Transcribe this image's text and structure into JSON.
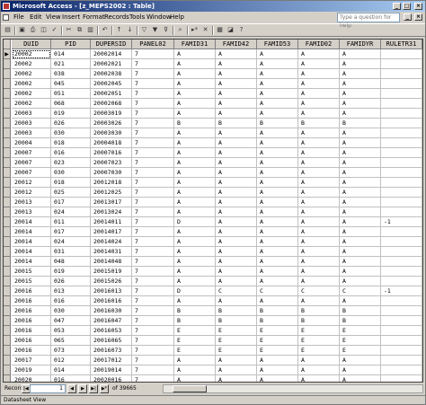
{
  "window": {
    "title": "Microsoft Access - [z_MEPS2002 : Table]"
  },
  "menu": [
    "File",
    "Edit",
    "View",
    "Insert",
    "Format",
    "Records",
    "Tools",
    "Window",
    "Help"
  ],
  "ask_placeholder": "Type a question for help",
  "columns": [
    "DUID",
    "PID",
    "DUPERSID",
    "PANEL02",
    "FAMID31",
    "FAMID42",
    "FAMID53",
    "FAMID02",
    "FAMIDYR",
    "RULETR31"
  ],
  "rows": [
    [
      "20002",
      "014",
      "20002014",
      "7",
      "A",
      "A",
      "A",
      "A",
      "A",
      ""
    ],
    [
      "20002",
      "021",
      "20002021",
      "7",
      "A",
      "A",
      "A",
      "A",
      "A",
      ""
    ],
    [
      "20002",
      "038",
      "20002038",
      "7",
      "A",
      "A",
      "A",
      "A",
      "A",
      ""
    ],
    [
      "20002",
      "045",
      "20002045",
      "7",
      "A",
      "A",
      "A",
      "A",
      "A",
      ""
    ],
    [
      "20002",
      "051",
      "20002051",
      "7",
      "A",
      "A",
      "A",
      "A",
      "A",
      ""
    ],
    [
      "20002",
      "068",
      "20002068",
      "7",
      "A",
      "A",
      "A",
      "A",
      "A",
      ""
    ],
    [
      "20003",
      "019",
      "20003019",
      "7",
      "A",
      "A",
      "A",
      "A",
      "A",
      ""
    ],
    [
      "20003",
      "026",
      "20003026",
      "7",
      "B",
      "B",
      "B",
      "B",
      "B",
      ""
    ],
    [
      "20003",
      "030",
      "20003030",
      "7",
      "A",
      "A",
      "A",
      "A",
      "A",
      ""
    ],
    [
      "20004",
      "018",
      "20004018",
      "7",
      "A",
      "A",
      "A",
      "A",
      "A",
      ""
    ],
    [
      "20007",
      "016",
      "20007016",
      "7",
      "A",
      "A",
      "A",
      "A",
      "A",
      ""
    ],
    [
      "20007",
      "023",
      "20007023",
      "7",
      "A",
      "A",
      "A",
      "A",
      "A",
      ""
    ],
    [
      "20007",
      "030",
      "20007030",
      "7",
      "A",
      "A",
      "A",
      "A",
      "A",
      ""
    ],
    [
      "20012",
      "018",
      "20012018",
      "7",
      "A",
      "A",
      "A",
      "A",
      "A",
      ""
    ],
    [
      "20012",
      "025",
      "20012025",
      "7",
      "A",
      "A",
      "A",
      "A",
      "A",
      ""
    ],
    [
      "20013",
      "017",
      "20013017",
      "7",
      "A",
      "A",
      "A",
      "A",
      "A",
      ""
    ],
    [
      "20013",
      "024",
      "20013024",
      "7",
      "A",
      "A",
      "A",
      "A",
      "A",
      ""
    ],
    [
      "20014",
      "011",
      "20014011",
      "7",
      "D",
      "A",
      "A",
      "A",
      "A",
      "-1"
    ],
    [
      "20014",
      "017",
      "20014017",
      "7",
      "A",
      "A",
      "A",
      "A",
      "A",
      ""
    ],
    [
      "20014",
      "024",
      "20014024",
      "7",
      "A",
      "A",
      "A",
      "A",
      "A",
      ""
    ],
    [
      "20014",
      "031",
      "20014031",
      "7",
      "A",
      "A",
      "A",
      "A",
      "A",
      ""
    ],
    [
      "20014",
      "048",
      "20014048",
      "7",
      "A",
      "A",
      "A",
      "A",
      "A",
      ""
    ],
    [
      "20015",
      "019",
      "20015019",
      "7",
      "A",
      "A",
      "A",
      "A",
      "A",
      ""
    ],
    [
      "20015",
      "026",
      "20015026",
      "7",
      "A",
      "A",
      "A",
      "A",
      "A",
      ""
    ],
    [
      "20016",
      "013",
      "20016013",
      "7",
      "D",
      "C",
      "C",
      "C",
      "C",
      "-1"
    ],
    [
      "20016",
      "016",
      "20016016",
      "7",
      "A",
      "A",
      "A",
      "A",
      "A",
      ""
    ],
    [
      "20016",
      "030",
      "20016030",
      "7",
      "B",
      "B",
      "B",
      "B",
      "B",
      ""
    ],
    [
      "20016",
      "047",
      "20016047",
      "7",
      "B",
      "B",
      "B",
      "B",
      "B",
      ""
    ],
    [
      "20016",
      "053",
      "20016053",
      "7",
      "E",
      "E",
      "E",
      "E",
      "E",
      ""
    ],
    [
      "20016",
      "065",
      "20016065",
      "7",
      "E",
      "E",
      "E",
      "E",
      "E",
      ""
    ],
    [
      "20016",
      "073",
      "20016073",
      "7",
      "E",
      "E",
      "E",
      "E",
      "E",
      ""
    ],
    [
      "20017",
      "012",
      "20017012",
      "7",
      "A",
      "A",
      "A",
      "A",
      "A",
      ""
    ],
    [
      "20019",
      "014",
      "20019014",
      "7",
      "A",
      "A",
      "A",
      "A",
      "A",
      ""
    ],
    [
      "20020",
      "016",
      "20020016",
      "7",
      "A",
      "A",
      "A",
      "A",
      "A",
      ""
    ]
  ],
  "nav": {
    "label": "Record:",
    "current": "1",
    "of_text": "of 39665"
  },
  "status": "Datasheet View"
}
